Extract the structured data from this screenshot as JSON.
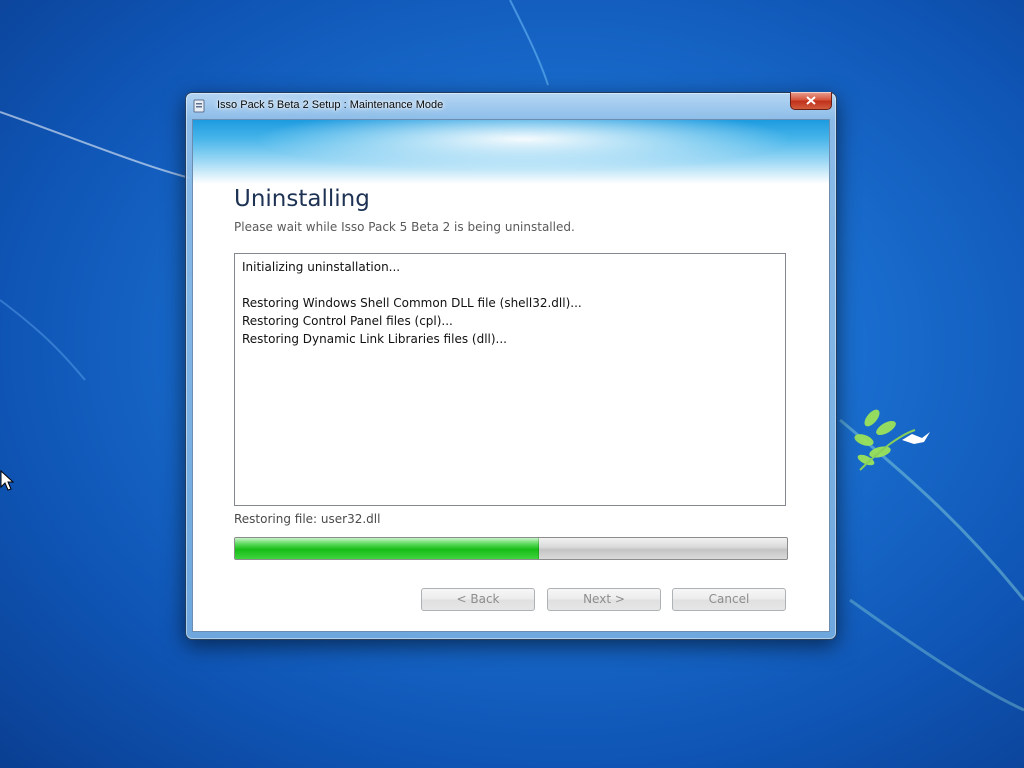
{
  "window": {
    "title": "Isso Pack 5 Beta 2 Setup : Maintenance Mode",
    "heading": "Uninstalling",
    "subheading": "Please wait while Isso Pack 5 Beta 2 is being uninstalled.",
    "log_lines": [
      "Initializing uninstallation...",
      "",
      "Restoring Windows Shell Common DLL file (shell32.dll)...",
      "Restoring Control Panel files (cpl)...",
      "Restoring Dynamic Link Libraries files (dll)..."
    ],
    "status_text": "Restoring file: user32.dll",
    "progress_percent": 55,
    "buttons": {
      "back": "< Back",
      "next": "Next >",
      "cancel": "Cancel"
    },
    "buttons_enabled": false
  },
  "icons": {
    "app": "setup-app-icon",
    "close": "close-icon",
    "cursor": "mouse-pointer-icon"
  },
  "colors": {
    "progress_fill": "#17bd17",
    "desktop_background": "#1a6fd0",
    "close_button": "#c0311b"
  }
}
